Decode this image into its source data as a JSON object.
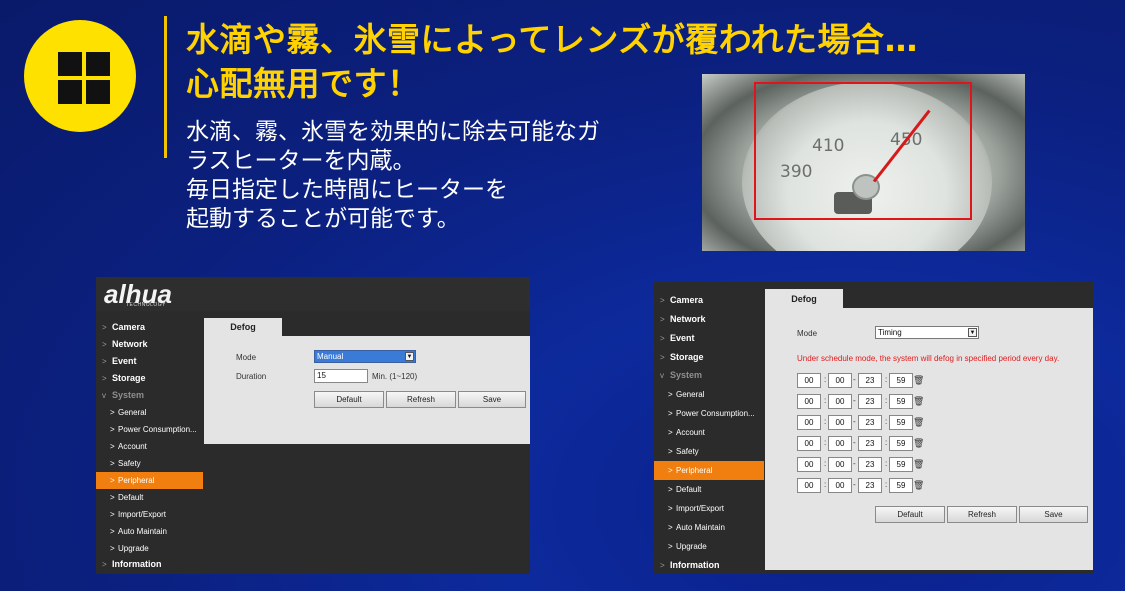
{
  "title": {
    "line1": "水滴や霧、氷雪によってレンズが覆われた場合…",
    "line2": "心配無用です！"
  },
  "description": {
    "lines": [
      "水滴、霧、氷雪を効果的に除去可能なガ",
      "ラスヒーターを内蔵。",
      "毎日指定した時間にヒーターを",
      "起動することが可能です。"
    ]
  },
  "photo": {
    "gauge_labels": [
      "410",
      "390",
      "450"
    ],
    "highlight_color": "#e0141a"
  },
  "shot1": {
    "brand": "alhua",
    "brand_sub": "TECHNOLOGY",
    "nav": [
      {
        "label": "Camera"
      },
      {
        "label": "Network"
      },
      {
        "label": "Event"
      },
      {
        "label": "Storage"
      },
      {
        "label": "System"
      },
      {
        "label": "General"
      },
      {
        "label": "Power Consumption..."
      },
      {
        "label": "Account"
      },
      {
        "label": "Safety"
      },
      {
        "label": "Peripheral"
      },
      {
        "label": "Default"
      },
      {
        "label": "Import/Export"
      },
      {
        "label": "Auto Maintain"
      },
      {
        "label": "Upgrade"
      },
      {
        "label": "Information"
      }
    ],
    "tab": "Defog",
    "mode_label": "Mode",
    "mode_value": "Manual",
    "duration_label": "Duration",
    "duration_value": "15",
    "duration_unit": "Min. (1~120)",
    "buttons": {
      "default": "Default",
      "refresh": "Refresh",
      "save": "Save"
    }
  },
  "shot2": {
    "nav": [
      {
        "label": "Camera"
      },
      {
        "label": "Network"
      },
      {
        "label": "Event"
      },
      {
        "label": "Storage"
      },
      {
        "label": "System"
      },
      {
        "label": "General"
      },
      {
        "label": "Power Consumption..."
      },
      {
        "label": "Account"
      },
      {
        "label": "Safety"
      },
      {
        "label": "Peripheral"
      },
      {
        "label": "Default"
      },
      {
        "label": "Import/Export"
      },
      {
        "label": "Auto Maintain"
      },
      {
        "label": "Upgrade"
      },
      {
        "label": "Information"
      }
    ],
    "tab": "Defog",
    "mode_label": "Mode",
    "mode_value": "Timing",
    "notice": "Under schedule mode, the system will defog in specified period every day.",
    "schedules": [
      {
        "start_h": "00",
        "start_m": "00",
        "end_h": "23",
        "end_m": "59"
      },
      {
        "start_h": "00",
        "start_m": "00",
        "end_h": "23",
        "end_m": "59"
      },
      {
        "start_h": "00",
        "start_m": "00",
        "end_h": "23",
        "end_m": "59"
      },
      {
        "start_h": "00",
        "start_m": "00",
        "end_h": "23",
        "end_m": "59"
      },
      {
        "start_h": "00",
        "start_m": "00",
        "end_h": "23",
        "end_m": "59"
      },
      {
        "start_h": "00",
        "start_m": "00",
        "end_h": "23",
        "end_m": "59"
      }
    ],
    "buttons": {
      "default": "Default",
      "refresh": "Refresh",
      "save": "Save"
    }
  },
  "colors": {
    "accent_yellow": "#ffd200",
    "nav_active": "#f07f0f"
  }
}
